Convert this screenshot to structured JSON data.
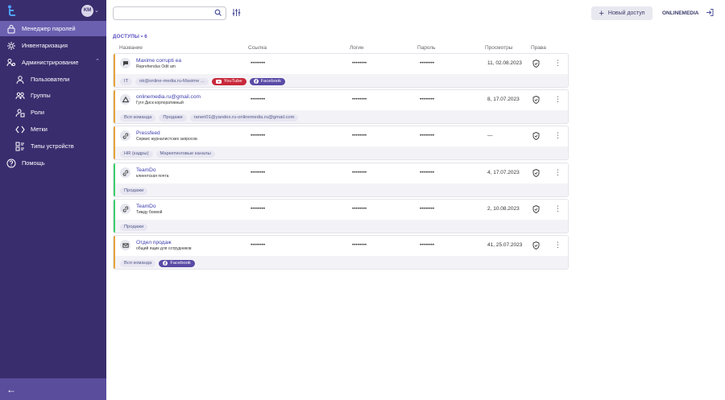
{
  "user": {
    "initials": "KM"
  },
  "colors": {
    "sidebar": "#3a2d6e",
    "active": "#6b5fb0",
    "accent_orange": "#e8a23b",
    "accent_green": "#3ccf6b",
    "link": "#3c3cb0",
    "youtube": "#c8283a",
    "facebook": "#5a4aa6"
  },
  "sidebar": {
    "items": [
      {
        "label": "Менеджер паролей",
        "icon": "lock-icon"
      },
      {
        "label": "Инвентаризация",
        "icon": "gear-icon"
      },
      {
        "label": "Администрирование",
        "icon": "admin-icon"
      },
      {
        "label": "Пользователи",
        "icon": "user-icon"
      },
      {
        "label": "Группы",
        "icon": "group-icon"
      },
      {
        "label": "Роли",
        "icon": "role-icon"
      },
      {
        "label": "Метки",
        "icon": "code-icon"
      },
      {
        "label": "Типы устройств",
        "icon": "device-types-icon"
      },
      {
        "label": "Помощь",
        "icon": "help-icon"
      }
    ]
  },
  "header": {
    "search_placeholder": "",
    "new_access_label": "Новый доступ",
    "org_name": "ONLINEMEDIA"
  },
  "list": {
    "title": "ДОСТУПЫ • 6",
    "columns": [
      "Название",
      "Ссылка",
      "Логин",
      "Пароль",
      "Просмотры",
      "Права"
    ],
    "rows": [
      {
        "name": "Maxime corrupti ea",
        "desc": "Reprehendus Odit am",
        "link": "••••••••",
        "login": "••••••••",
        "password": "••••••••",
        "views": "11, 02.08.2023",
        "icon": "chat-icon",
        "tags": [
          {
            "label": "IT"
          },
          {
            "label": "ok@online-media.ru-Maxime ..."
          },
          {
            "label": "YouTube",
            "kind": "yt"
          },
          {
            "label": "Facebook",
            "kind": "fb"
          }
        ]
      },
      {
        "name": "onlinemedia.ru@gmail.com",
        "desc": "Гугл Диск корпоративный",
        "link": "••••••••",
        "login": "••••••••",
        "password": "••••••••",
        "views": "8, 17.07.2023",
        "icon": "drive-icon",
        "tags": [
          {
            "label": "Вся команда"
          },
          {
            "label": "Продажи"
          },
          {
            "label": "raneri01@yandex.ru-onlinemedia.ru@gmail.com"
          }
        ]
      },
      {
        "name": "Pressfeed",
        "desc": "Сервис журналистских запросов",
        "link": "••••••••",
        "login": "••••••••",
        "password": "••••••••",
        "views": "—",
        "icon": "link-icon",
        "tags": [
          {
            "label": "HR (кадры)"
          },
          {
            "label": "Маркетинговые каналы"
          }
        ]
      },
      {
        "name": "TeamDo",
        "desc": "клиентская почта",
        "link": "••••••••",
        "login": "••••••••",
        "password": "••••••••",
        "views": "4, 17.07.2023",
        "icon": "link-icon",
        "tags": [
          {
            "label": "Продажи"
          }
        ]
      },
      {
        "name": "TeamDo",
        "desc": "Тимду боевой",
        "link": "••••••••",
        "login": "••••••••",
        "password": "••••••••",
        "views": "2, 10.08.2023",
        "icon": "link-icon",
        "tags": [
          {
            "label": "Продажи"
          }
        ]
      },
      {
        "name": "Отдел продаж",
        "desc": "общий ящик для сотрудников",
        "link": "••••••••",
        "login": "••••••••",
        "password": "••••••••",
        "views": "41, 25.07.2023",
        "icon": "mail-icon",
        "tags": [
          {
            "label": "Вся команда"
          },
          {
            "label": "Facebook",
            "kind": "fb"
          }
        ]
      }
    ]
  }
}
